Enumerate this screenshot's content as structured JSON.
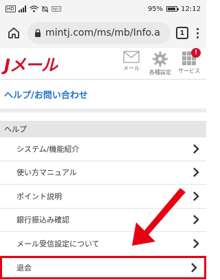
{
  "status_bar": {
    "left_icons": [
      "hd-icon",
      "signal-icon",
      "wifi-icon",
      "mute-icon",
      "nfc-icon"
    ],
    "hd_label": "HD",
    "battery": "95%",
    "time": "12:12",
    "battery_level": 0.95
  },
  "browser": {
    "url": "mintj.com/ms/mb/Info.a",
    "tab_count": "1"
  },
  "site_header": {
    "logo_main": "Jメール",
    "nav": [
      {
        "label": "メール",
        "icon": "mail-icon"
      },
      {
        "label": "各種設定",
        "icon": "gear-icon"
      },
      {
        "label": "サービス",
        "icon": "grid-icon",
        "badge": "!"
      }
    ]
  },
  "page_title": "ヘルプ/お問い合わせ",
  "section_title": "ヘルプ",
  "menu_items": [
    {
      "label": "システム/機能紹介"
    },
    {
      "label": "使い方マニュアル"
    },
    {
      "label": "ポイント説明"
    },
    {
      "label": "銀行振込み確認"
    },
    {
      "label": "メール受信設定について"
    },
    {
      "label": "退会"
    }
  ],
  "colors": {
    "brand_red": "#d40f2b",
    "link_blue": "#2271c6",
    "highlight_red": "#e60012"
  }
}
